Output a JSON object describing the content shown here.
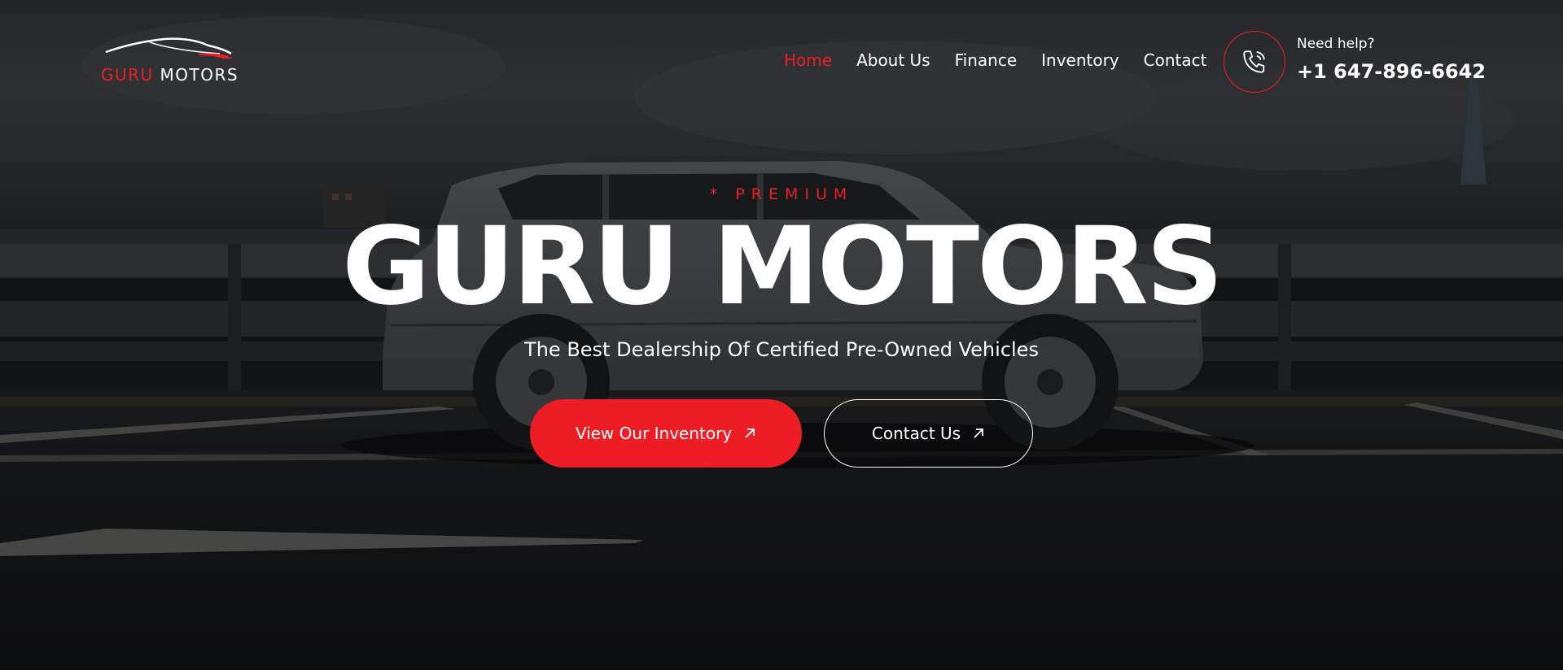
{
  "logo": {
    "text_red": "GURU",
    "text_white": "MOTORS"
  },
  "nav": {
    "items": [
      {
        "label": "Home",
        "active": true
      },
      {
        "label": "About Us",
        "active": false
      },
      {
        "label": "Finance",
        "active": false
      },
      {
        "label": "Inventory",
        "active": false
      },
      {
        "label": "Contact",
        "active": false
      }
    ]
  },
  "contact": {
    "help_label": "Need help?",
    "phone": "+1 647-896-6642",
    "icon": "phone-icon"
  },
  "hero": {
    "eyebrow": "* PREMIUM",
    "title": "GURU MOTORS",
    "tagline": "The Best Dealership Of Certified Pre-Owned Vehicles",
    "primary_button": {
      "label": "View Our Inventory",
      "icon": "arrow-up-right-icon"
    },
    "secondary_button": {
      "label": "Contact Us",
      "icon": "arrow-up-right-icon"
    }
  },
  "colors": {
    "accent": "#ee1c25",
    "text": "#ffffff",
    "background": "#1b1d20"
  }
}
